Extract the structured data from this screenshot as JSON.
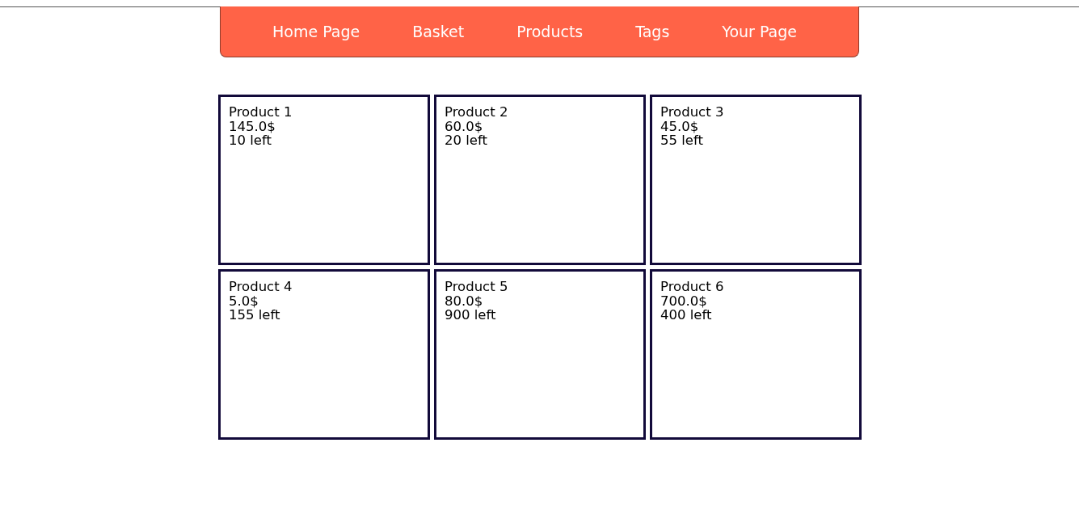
{
  "nav": {
    "links": [
      "Home Page",
      "Basket",
      "Products",
      "Tags",
      "Your Page"
    ]
  },
  "products": [
    {
      "name": "Product 1",
      "price": "145.0$",
      "stock": "10 left"
    },
    {
      "name": "Product 2",
      "price": "60.0$",
      "stock": "20 left"
    },
    {
      "name": "Product 3",
      "price": "45.0$",
      "stock": "55 left"
    },
    {
      "name": "Product 4",
      "price": "5.0$",
      "stock": "155 left"
    },
    {
      "name": "Product 5",
      "price": "80.0$",
      "stock": "900 left"
    },
    {
      "name": "Product 6",
      "price": "700.0$",
      "stock": "400 left"
    }
  ]
}
